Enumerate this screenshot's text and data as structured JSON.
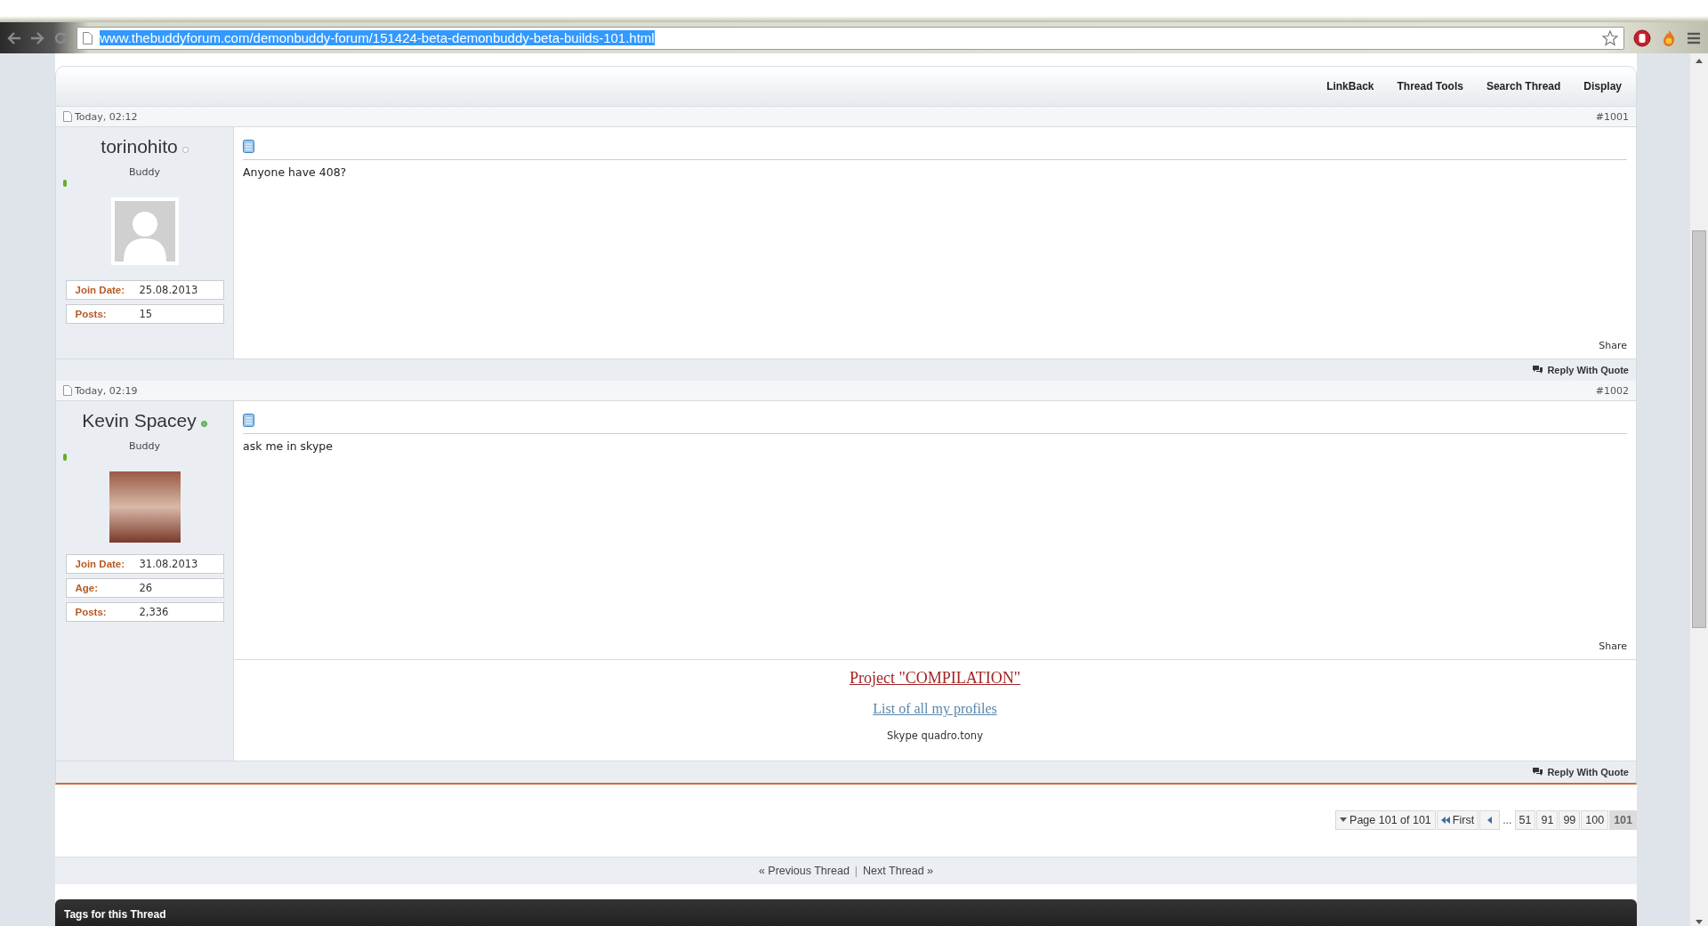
{
  "browser": {
    "url": "www.thebuddyforum.com/demonbuddy-forum/151424-beta-demonbuddy-beta-builds-101.html",
    "url_selected": true
  },
  "thread_tools": [
    "LinkBack",
    "Thread Tools",
    "Search Thread",
    "Display"
  ],
  "posts": [
    {
      "date": "Today, 02:12",
      "number": "#1001",
      "username": "torinohito",
      "online": false,
      "rank": "Buddy",
      "avatar": {
        "kind": "default"
      },
      "fields": [
        {
          "label": "Join Date:",
          "value": "25.08.2013"
        },
        {
          "label": "Posts:",
          "value": "15"
        }
      ],
      "message": "Anyone have 408?",
      "share": "Share",
      "reply": "Reply With Quote"
    },
    {
      "date": "Today, 02:19",
      "number": "#1002",
      "username": "Kevin Spacey",
      "online": true,
      "rank": "Buddy",
      "avatar": {
        "kind": "photo"
      },
      "fields": [
        {
          "label": "Join Date:",
          "value": "31.08.2013"
        },
        {
          "label": "Age:",
          "value": "26"
        },
        {
          "label": "Posts:",
          "value": "2,336"
        }
      ],
      "message": "ask me in skype",
      "share": "Share",
      "signature": [
        {
          "kind": "title-link",
          "text": "Project \"COMPILATION\""
        },
        {
          "kind": "link",
          "text": "List of all my profiles"
        },
        {
          "kind": "text",
          "text": "Skype quadro.tony"
        }
      ],
      "reply": "Reply With Quote"
    }
  ],
  "pagination": {
    "label": "Page 101 of 101",
    "first": "First",
    "ellipsis": "...",
    "pages": [
      {
        "label": "51",
        "selected": false
      },
      {
        "label": "91",
        "selected": false
      },
      {
        "label": "99",
        "selected": false
      },
      {
        "label": "100",
        "selected": false
      },
      {
        "label": "101",
        "selected": true
      }
    ]
  },
  "thread_nav": {
    "previous": "« Previous Thread",
    "separator": "|",
    "next": "Next Thread »"
  },
  "tags_title": "Tags for this Thread"
}
